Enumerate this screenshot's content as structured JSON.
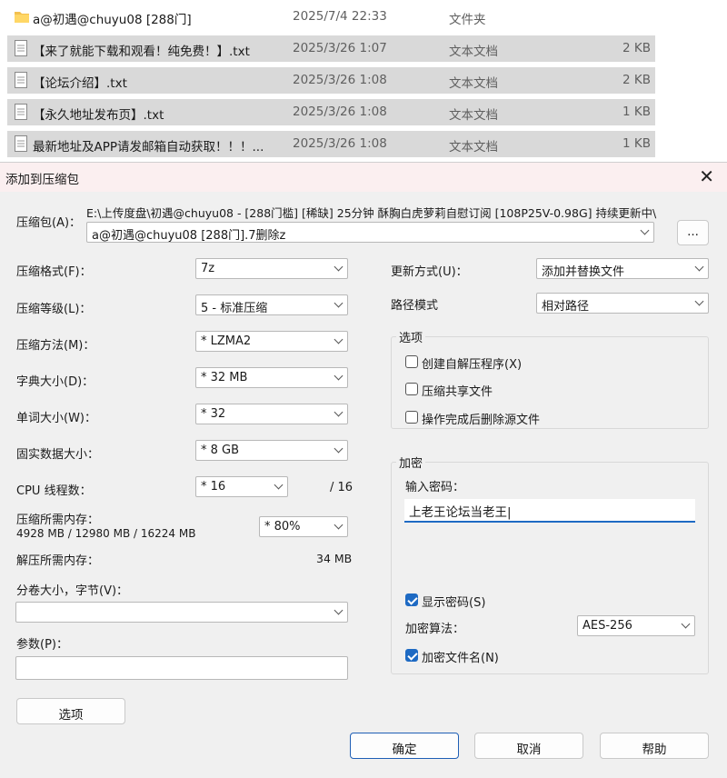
{
  "files": [
    {
      "name": "a@初遇@chuyu08 [288门]",
      "date": "2025/7/4 22:33",
      "type": "文件夹",
      "size": "",
      "icon": "folder-icon",
      "selected": false
    },
    {
      "name": "【来了就能下载和观看！纯免费！】.txt",
      "date": "2025/3/26 1:07",
      "type": "文本文档",
      "size": "2 KB",
      "icon": "text-file-icon",
      "selected": true
    },
    {
      "name": "【论坛介绍】.txt",
      "date": "2025/3/26 1:08",
      "type": "文本文档",
      "size": "2 KB",
      "icon": "text-file-icon",
      "selected": true
    },
    {
      "name": "【永久地址发布页】.txt",
      "date": "2025/3/26 1:08",
      "type": "文本文档",
      "size": "1 KB",
      "icon": "text-file-icon",
      "selected": true
    },
    {
      "name": "最新地址及APP请发邮箱自动获取！！！...",
      "date": "2025/3/26 1:08",
      "type": "文本文档",
      "size": "1 KB",
      "icon": "text-file-icon",
      "selected": true
    }
  ],
  "dialog": {
    "title": "添加到压缩包",
    "archive_label": "压缩包(A)：",
    "archive_path": "E:\\上传度盘\\初遇@chuyu08 - [288门槛] [稀缺] 25分钟 酥胸白虎萝莉自慰订阅 [108P25V-0.98G] 持续更新中\\",
    "archive_name": "a@初遇@chuyu08 [288门].7删除z",
    "browse_label": "...",
    "left": {
      "format_label": "压缩格式(F)：",
      "format_value": "7z",
      "level_label": "压缩等级(L)：",
      "level_value": "5 - 标准压缩",
      "method_label": "压缩方法(M)：",
      "method_value": "* LZMA2",
      "dict_label": "字典大小(D)：",
      "dict_value": "* 32 MB",
      "word_label": "单词大小(W)：",
      "word_value": "* 32",
      "solid_label": "固实数据大小：",
      "solid_value": "* 8 GB",
      "threads_label": "CPU 线程数：",
      "threads_value": "* 16",
      "threads_total": "/ 16",
      "mem_label": "压缩所需内存：",
      "mem_detail": "4928 MB / 12980 MB / 16224 MB",
      "mem_value": "* 80%",
      "decomp_label": "解压所需内存：",
      "decomp_value": "34 MB",
      "volume_label": "分卷大小，字节(V)：",
      "volume_value": "",
      "params_label": "参数(P)：",
      "params_value": "",
      "options_button": "选项"
    },
    "right": {
      "update_label": "更新方式(U)：",
      "update_value": "添加并替换文件",
      "path_label": "路径模式",
      "path_value": "相对路径",
      "options_group": "选项",
      "opt_sfx": {
        "label": "创建自解压程序(X)",
        "checked": false
      },
      "opt_shared": {
        "label": "压缩共享文件",
        "checked": false
      },
      "opt_delete": {
        "label": "操作完成后删除源文件",
        "checked": false
      },
      "encrypt_group": "加密",
      "password_label": "输入密码：",
      "password_value": "上老王论坛当老王|",
      "show_password": {
        "label": "显示密码(S)",
        "checked": true
      },
      "algo_label": "加密算法：",
      "algo_value": "AES-256",
      "encrypt_names": {
        "label": "加密文件名(N)",
        "checked": true
      }
    },
    "ok_button": "确定",
    "cancel_button": "取消",
    "help_button": "帮助"
  }
}
